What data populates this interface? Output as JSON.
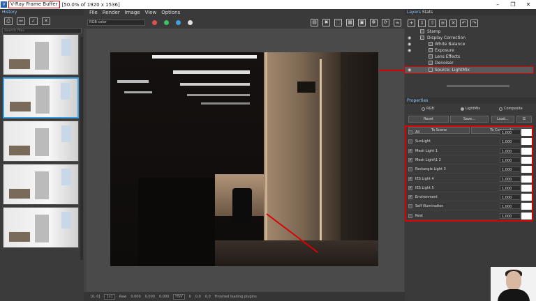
{
  "window": {
    "title": "V-Ray Frame Buffer",
    "subtitle": "[50.0% of 1920 x 1536]",
    "controls": [
      "–",
      "❐",
      "✕"
    ]
  },
  "history": {
    "header": "History",
    "search_placeholder": "Search files",
    "tool_icons": [
      "save-history-icon",
      "compare-ab-icon",
      "load-history-icon",
      "clear-history-icon"
    ]
  },
  "menu": [
    "File",
    "Render",
    "Image",
    "View",
    "Options"
  ],
  "toolbar": {
    "channel": "RGB color",
    "dot_colors": [
      "#e05050",
      "#40c060",
      "#40a0e0",
      "#e0e0e0"
    ]
  },
  "status": {
    "coords": "[0, 0]",
    "mode": "1x1",
    "raw_label": "Raw",
    "values": [
      "0.000",
      "0.000",
      "0.000"
    ],
    "color_mode": "HSV",
    "hsv_values": [
      "0",
      "0.0",
      "0.0"
    ],
    "message": "Finished loading plugins"
  },
  "panel_tabs": [
    "Layers",
    "Stats"
  ],
  "layers": [
    {
      "label": "Stamp",
      "eye": false
    },
    {
      "label": "Display Correction",
      "eye": true
    },
    {
      "label": "White Balance",
      "eye": true
    },
    {
      "label": "Exposure",
      "eye": true
    },
    {
      "label": "Lens Effects",
      "eye": false
    },
    {
      "label": "Denoiser",
      "eye": false
    },
    {
      "label": "Source: LightMix",
      "eye": true
    }
  ],
  "properties": {
    "header": "Properties",
    "modes": [
      {
        "label": "RGB",
        "on": false
      },
      {
        "label": "LightMix",
        "on": true
      },
      {
        "label": "Composite",
        "on": false
      }
    ],
    "buttons": {
      "reset": "Reset",
      "save": "Save...",
      "load": "Load...",
      "to_scene": "To Scene",
      "to_composite": "To Composite"
    }
  },
  "lightmix": [
    {
      "name": "All",
      "checked": false,
      "value": "1,000"
    },
    {
      "name": "SunLight",
      "checked": false,
      "value": "1,000"
    },
    {
      "name": "Mesh Light 1",
      "checked": true,
      "value": "1,000"
    },
    {
      "name": "Mesh Light\\1 2",
      "checked": true,
      "value": "1,000"
    },
    {
      "name": "Rectangle Light 3",
      "checked": false,
      "value": "1,000"
    },
    {
      "name": "IES Light 4",
      "checked": true,
      "value": "1,000"
    },
    {
      "name": "IES Light 5",
      "checked": true,
      "value": "1,000"
    },
    {
      "name": "Environment",
      "checked": true,
      "value": "1,000"
    },
    {
      "name": "Self Illumination",
      "checked": false,
      "value": "1,000"
    },
    {
      "name": "Rest",
      "checked": false,
      "value": "1,000"
    }
  ]
}
